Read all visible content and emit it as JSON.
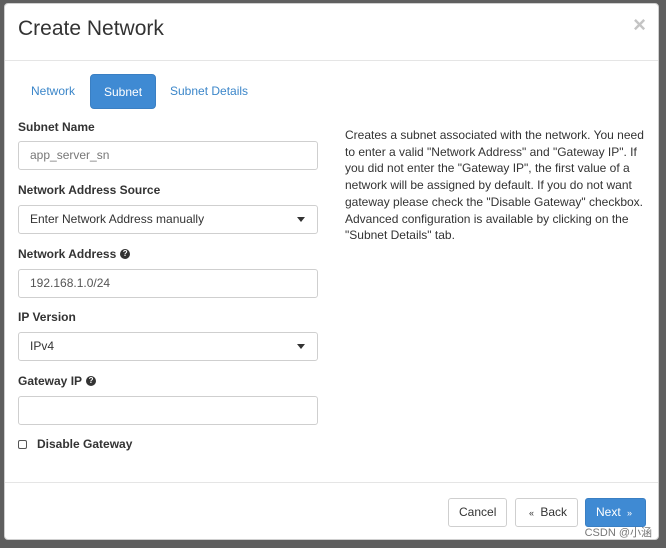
{
  "modal": {
    "title": "Create Network",
    "close_symbol": "×"
  },
  "tabs": [
    {
      "label": "Network",
      "active": false
    },
    {
      "label": "Subnet",
      "active": true
    },
    {
      "label": "Subnet Details",
      "active": false
    }
  ],
  "form": {
    "subnet_name": {
      "label": "Subnet Name",
      "value": "app_server_sn"
    },
    "network_address_source": {
      "label": "Network Address Source",
      "selected": "Enter Network Address manually"
    },
    "network_address": {
      "label": "Network Address",
      "value": "192.168.1.0/24",
      "help_icon": "question-circle-icon"
    },
    "ip_version": {
      "label": "IP Version",
      "selected": "IPv4"
    },
    "gateway_ip": {
      "label": "Gateway IP",
      "value": "",
      "help_icon": "question-circle-icon"
    },
    "disable_gateway": {
      "label": "Disable Gateway",
      "checked": false
    }
  },
  "help_text": "Creates a subnet associated with the network. You need to enter a valid \"Network Address\" and \"Gateway IP\". If you did not enter the \"Gateway IP\", the first value of a network will be assigned by default. If you do not want gateway please check the \"Disable Gateway\" checkbox. Advanced configuration is available by clicking on the \"Subnet Details\" tab.",
  "footer": {
    "cancel_label": "Cancel",
    "back_label": "Back",
    "back_arrow": "«",
    "next_label": "Next",
    "next_arrow": "»"
  },
  "watermark": "CSDN @小涵",
  "colors": {
    "primary": "#3f8ad3",
    "link": "#3b86c9"
  }
}
